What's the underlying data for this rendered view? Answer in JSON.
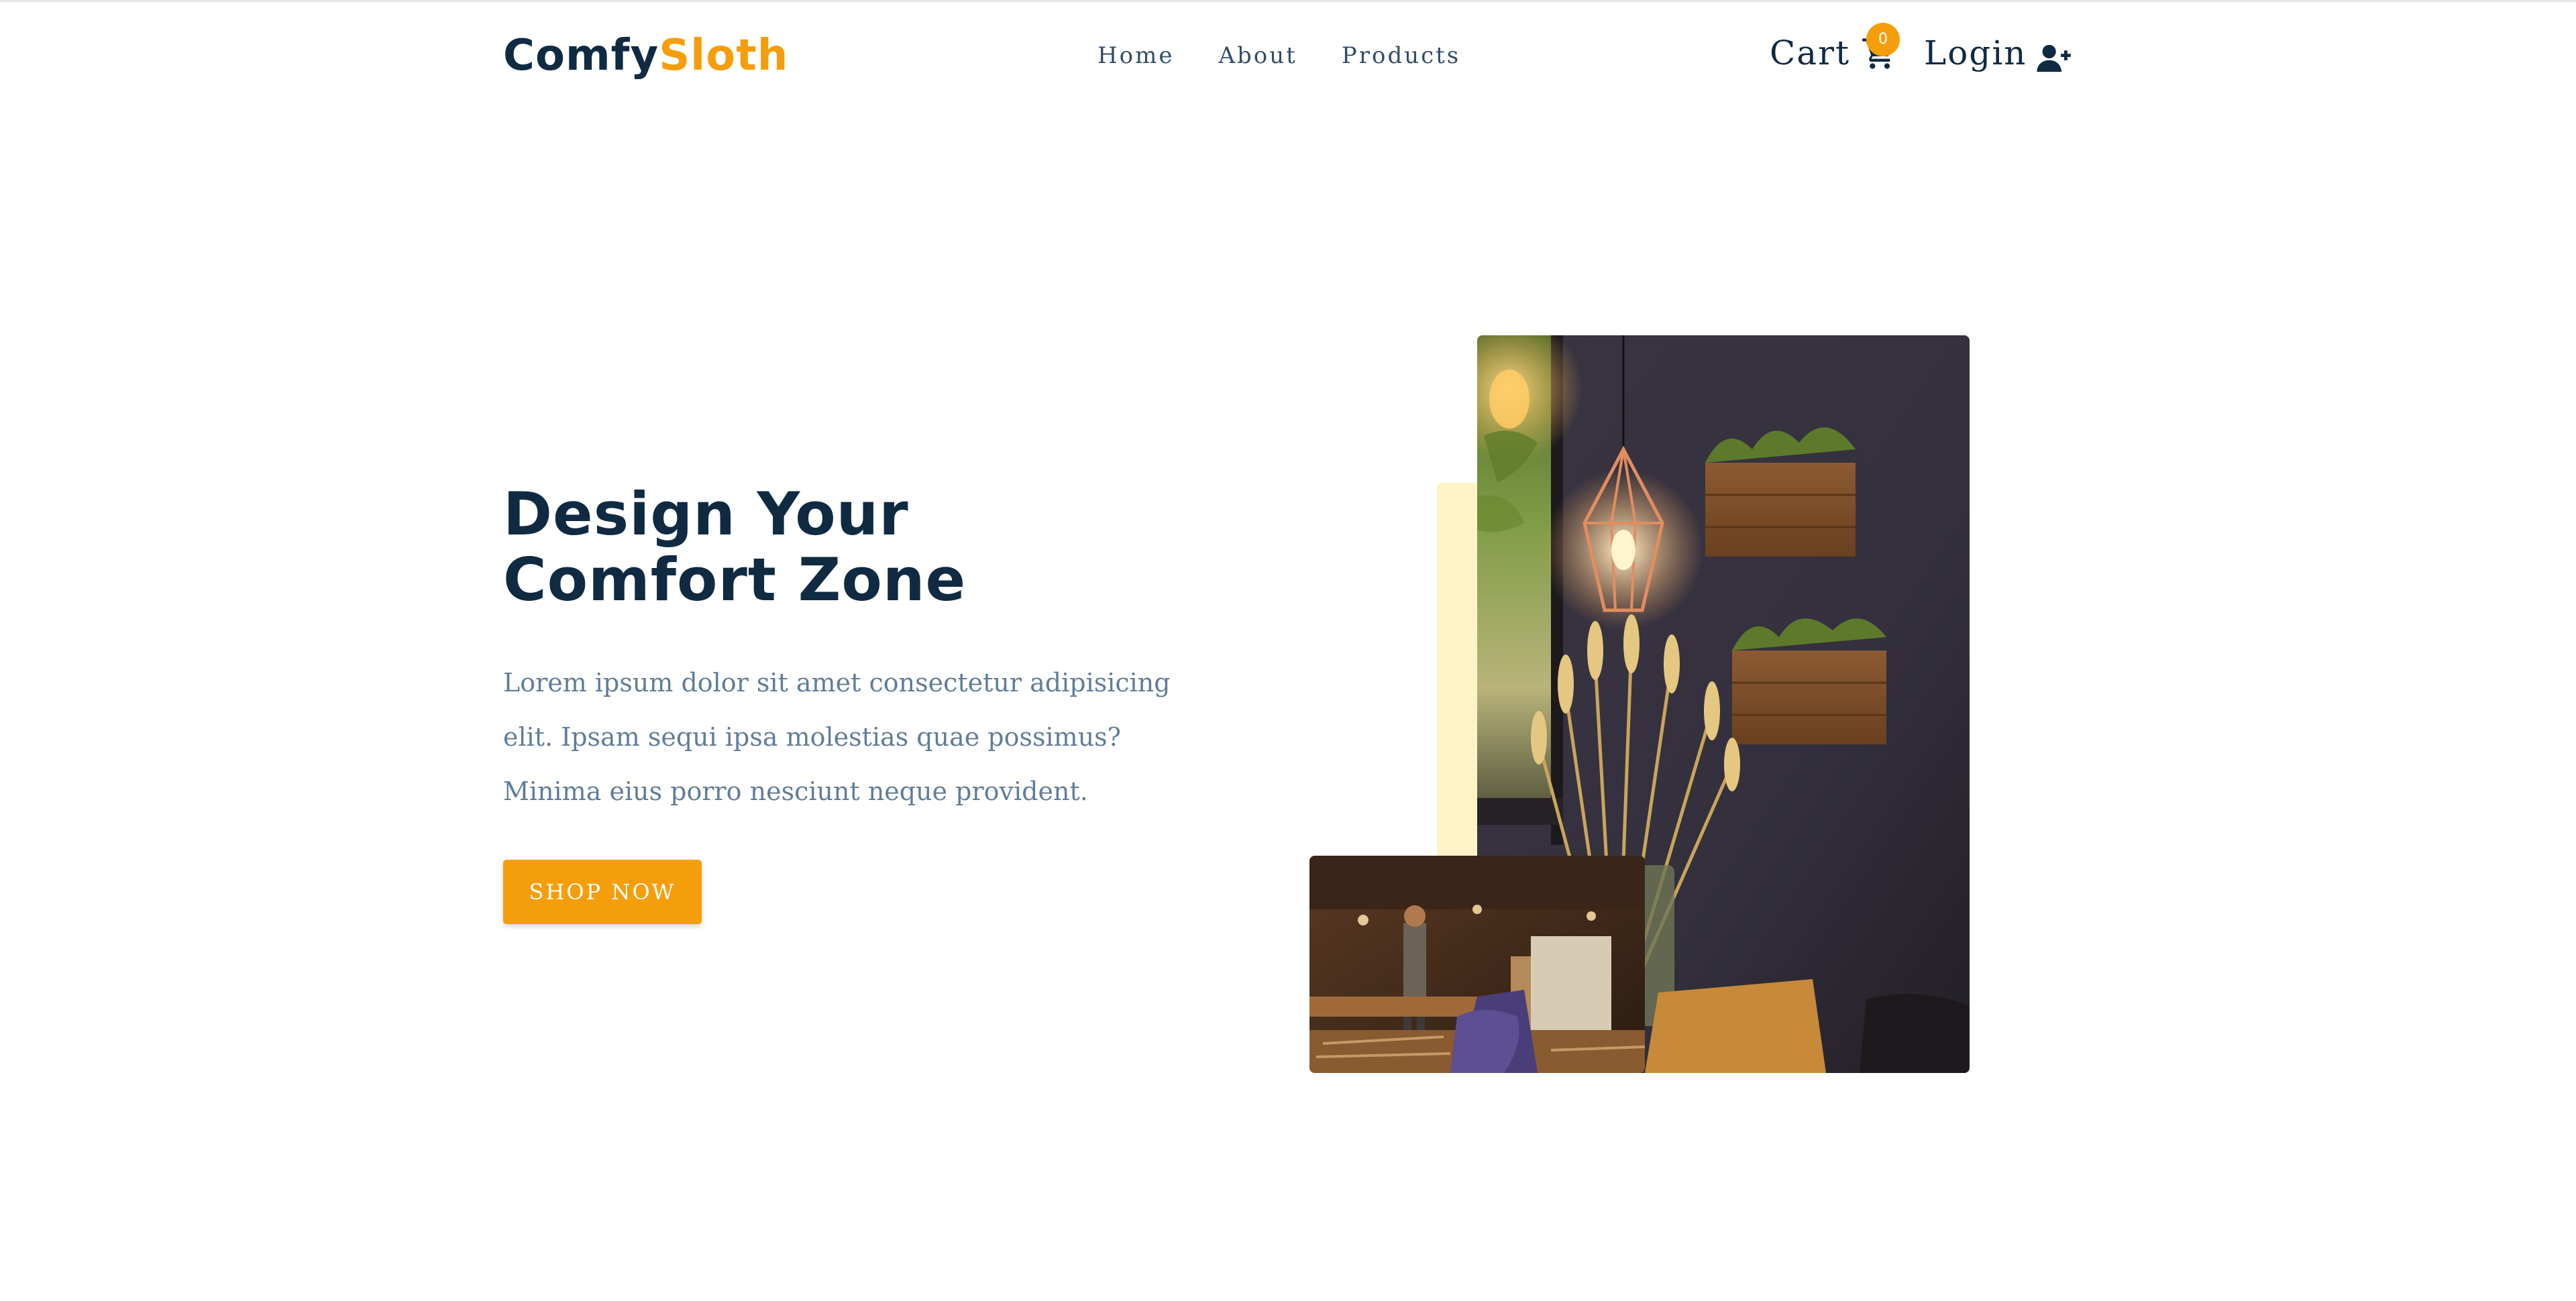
{
  "brand": {
    "name_primary": "Comfy",
    "name_accent": "Sloth",
    "accent_color": "#f59e0b",
    "primary_color": "#102a42"
  },
  "nav": {
    "links": [
      {
        "label": "Home"
      },
      {
        "label": "About"
      },
      {
        "label": "Products"
      }
    ],
    "cart_label": "Cart",
    "cart_count": "0",
    "cart_icon": "shopping-cart-icon",
    "login_label": "Login",
    "login_icon": "user-plus-icon"
  },
  "hero": {
    "title_line1": "Design Your",
    "title_line2": "Comfort Zone",
    "description": "Lorem ipsum dolor sit amet consectetur adipisicing elit. Ipsam sequi ipsa molestias quae possimus? Minima eius porro nesciunt neque provident.",
    "button_label": "SHOP NOW",
    "text_color": "#617d98"
  }
}
